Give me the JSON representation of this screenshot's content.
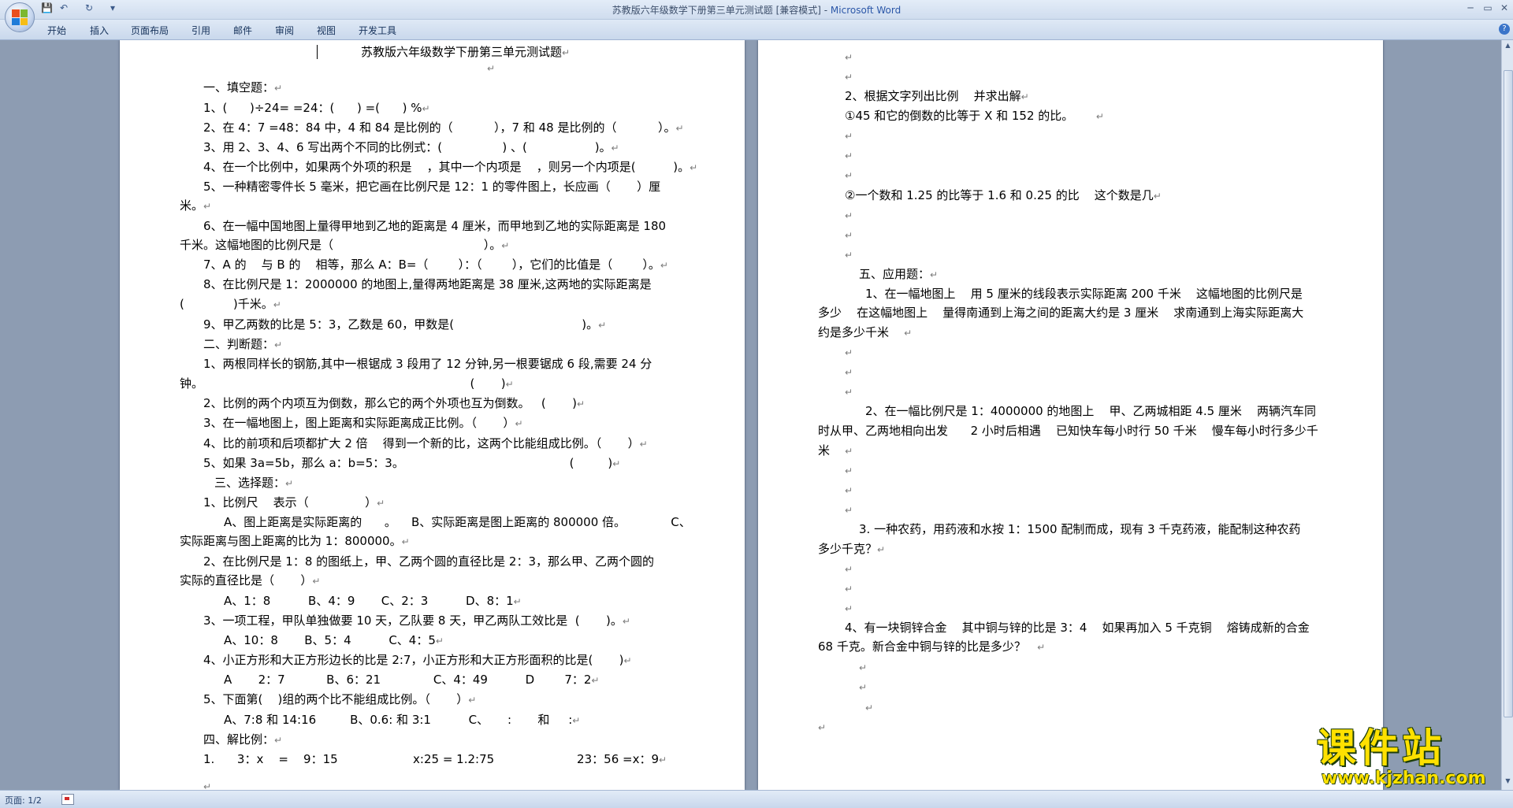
{
  "window": {
    "title": "苏教版六年级数学下册第三单元测试题 [兼容模式] - ",
    "app_name": "Microsoft Word",
    "minimize": "─",
    "maximize": "▭",
    "close": "✕"
  },
  "quick_access": {
    "save_icon": "💾",
    "undo_icon": "↶",
    "redo_icon": "↻",
    "dropdown_icon": "▾"
  },
  "ribbon": {
    "tabs": [
      "开始",
      "插入",
      "页面布局",
      "引用",
      "邮件",
      "审阅",
      "视图",
      "开发工具"
    ],
    "help": "?"
  },
  "colors": {
    "office_logo": [
      "#e94f1e",
      "#7cb82f",
      "#1f7bd8",
      "#f6bd17"
    ],
    "watermark": "#ffe100"
  },
  "pages": {
    "left": [
      "苏教版六年级数学下册第三单元测试题↵",
      "↵",
      "一、填空题：↵",
      "1、(      )÷24= =24：(      ) =(      ) %↵",
      "2、在 4：7 =48：84 中，4 和 84 是比例的（           ），7 和 48 是比例的（           ）。↵",
      "3、用 2、3、4、6 写出两个不同的比例式：(                ) 、(                  )。↵",
      "4、在一个比例中，如果两个外项的积是    ，其中一个内项是    ，则另一个内项是(          )。↵",
      "5、一种精密零件长 5 毫米，把它画在比例尺是 12：1 的零件图上，长应画（       ）厘",
      "米。↵",
      "6、在一幅中国地图上量得甲地到乙地的距离是 4 厘米，而甲地到乙地的实际距离是 180",
      "千米。这幅地图的比例尺是（                                        ）。↵",
      "7、A 的    与 B 的    相等，那么 A：B=（        ）：（        ），它们的比值是（        ）。↵",
      "8、在比例尺是 1：2000000 的地图上,量得两地距离是 38 厘米,这两地的实际距离是",
      "(             )千米。↵",
      "9、甲乙两数的比是 5：3，乙数是 60，甲数是(                                  )。↵",
      "二、判断题：↵",
      "1、两根同样长的钢筋,其中一根锯成 3 段用了 12 分钟,另一根要锯成 6 段,需要 24 分",
      "钟。                                                                       (       )↵",
      "2、比例的两个内项互为倒数，那么它的两个外项也互为倒数。   (       )↵",
      "3、在一幅地图上，图上距离和实际距离成正比例。（       ）↵",
      "4、比的前项和后项都扩大 2 倍    得到一个新的比，这两个比能组成比例。（       ）↵",
      "5、如果 3a=5b，那么 a：b=5：3。                                            (         )↵",
      "三、选择题：↵",
      "1、比例尺    表示（               ）↵",
      "A、图上距离是实际距离的      。    B、实际距离是图上距离的 800000 倍。            C、",
      "实际距离与图上距离的比为 1：800000。↵",
      "2、在比例尺是 1：8 的图纸上，甲、乙两个圆的直径比是 2：3，那么甲、乙两个圆的",
      "实际的直径比是（       ）↵",
      "A、1：8          B、4：9       C、2：3          D、8：1↵",
      "3、一项工程，甲队单独做要 10 天，乙队要 8 天，甲乙两队工效比是  (       )。↵",
      "A、10：8       B、5：4          C、4：5↵",
      "4、小正方形和大正方形边长的比是 2:7，小正方形和大正方形面积的比是(       )↵",
      "A       2：7           B、6：21              C、4：49          D        7：2↵",
      "5、下面第(    )组的两个比不能组成比例。（       ）↵",
      "A、7:8 和 14:16         B、0.6: 和 3:1          C、     :       和     :↵",
      "四、解比例：↵",
      "1.      3：x    =    9：15                    x:25 = 1.2:75                      23：56 =x：9↵",
      "↵"
    ],
    "right": [
      "↵",
      "↵",
      "2、根据文字列出比例    并求出解↵",
      "①45 和它的倒数的比等于 X 和 152 的比。      ↵",
      "↵",
      "↵",
      "↵",
      "②一个数和 1.25 的比等于 1.6 和 0.25 的比    这个数是几↵",
      "↵",
      "↵",
      "↵",
      "五、应用题：↵",
      "1、在一幅地图上    用 5 厘米的线段表示实际距离 200 千米    这幅地图的比例尺是",
      "多少    在这幅地图上    量得南通到上海之间的距离大约是 3 厘米    求南通到上海实际距离大",
      "约是多少千米    ↵",
      "↵",
      "↵",
      "↵",
      "2、在一幅比例尺是 1：4000000 的地图上    甲、乙两城相距 4.5 厘米    两辆汽车同",
      "时从甲、乙两地相向出发      2 小时后相遇    已知快车每小时行 50 千米    慢车每小时行多少千",
      "米    ↵",
      "↵",
      "↵",
      "↵",
      "3. 一种农药，用药液和水按 1：1500 配制而成，现有 3 千克药液，能配制这种农药",
      "多少千克？↵",
      "↵",
      "↵",
      "↵",
      "4、有一块铜锌合金    其中铜与锌的比是 3：4    如果再加入 5 千克铜    熔铸成新的合金",
      "68 千克。新合金中铜与锌的比是多少？   ↵",
      "↵",
      "↵",
      "↵",
      "↵"
    ]
  },
  "status": {
    "page_indicator": "页面: 1/2"
  },
  "watermark": {
    "main": "课件站",
    "url": "www.kjzhan.com"
  }
}
